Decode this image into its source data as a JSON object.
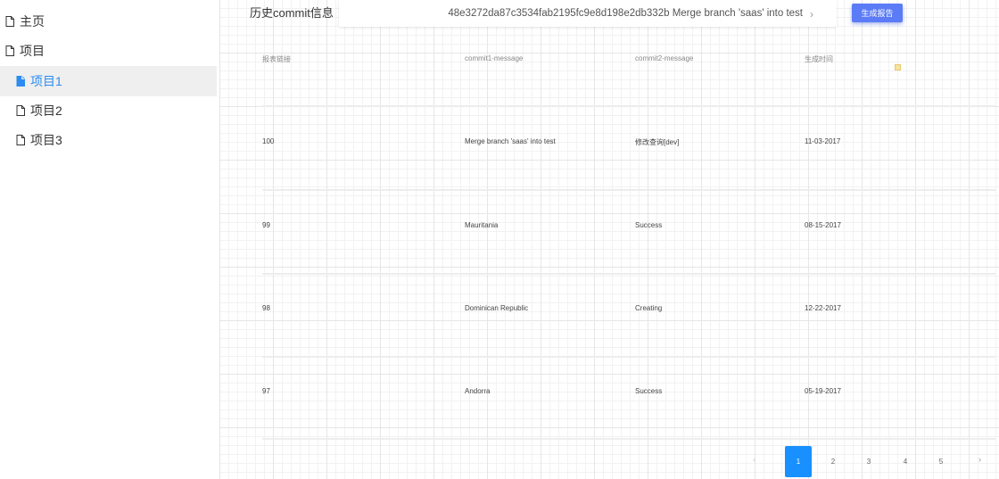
{
  "sidebar": {
    "items": [
      {
        "label": "主页",
        "level": "top",
        "active": false
      },
      {
        "label": "项目",
        "level": "top",
        "active": false
      },
      {
        "label": "项目1",
        "level": "sub",
        "active": true
      },
      {
        "label": "项目2",
        "level": "sub",
        "active": false
      },
      {
        "label": "项目3",
        "level": "sub",
        "active": false
      }
    ]
  },
  "header": {
    "history_label": "历史commit信息",
    "commit_select_value": "48e3272da87c3534fab2195fc9e8d198e2db332b Merge branch 'saas' into test",
    "generate_button": "生成报告"
  },
  "table": {
    "columns": [
      "报表链接",
      "commit1-message",
      "commit2-message",
      "生成时间"
    ],
    "rows": [
      [
        "100",
        "Merge branch 'saas' into test",
        "修改查询[dev]",
        "11-03-2017"
      ],
      [
        "99",
        "Mauritania",
        "Success",
        "08-15-2017"
      ],
      [
        "98",
        "Dominican Republic",
        "Creating",
        "12-22-2017"
      ],
      [
        "97",
        "Andorra",
        "Success",
        "05-19-2017"
      ]
    ]
  },
  "pagination": {
    "prev": "‹",
    "pages": [
      "1",
      "2",
      "3",
      "4",
      "5"
    ],
    "current": "1",
    "next": "›"
  },
  "colors": {
    "accent": "#2d8cf0",
    "button": "#5b7cf6",
    "page_active": "#1890ff"
  },
  "icons": {
    "nav": "document-icon",
    "select": "chevron-right-icon"
  }
}
